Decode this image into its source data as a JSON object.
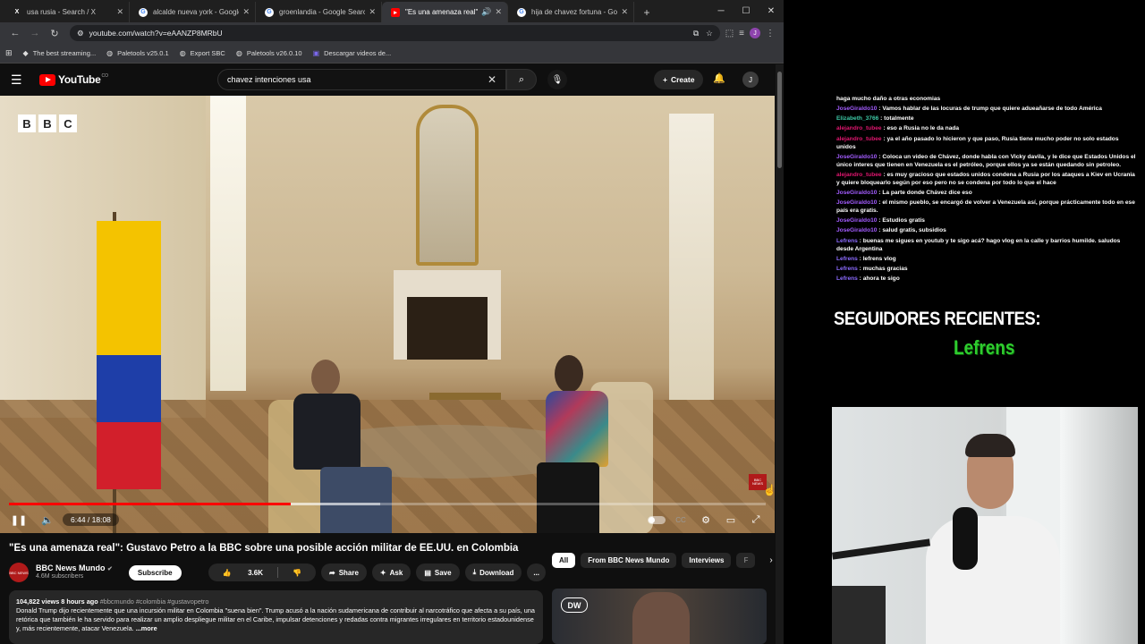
{
  "browser": {
    "tabs": [
      {
        "title": "usa rusia - Search / X",
        "icon": "x-logo-icon",
        "active": false
      },
      {
        "title": "alcalde nueva york - Google Se",
        "icon": "google-icon",
        "active": false
      },
      {
        "title": "groenlandia - Google Search",
        "icon": "google-icon",
        "active": false
      },
      {
        "title": "\"Es una amenaza real\": Gus",
        "icon": "youtube-icon",
        "active": true
      },
      {
        "title": "hija de chavez fortuna - Googl",
        "icon": "google-icon",
        "active": false
      }
    ],
    "new_tab": "+",
    "url": "youtube.com/watch?v=eAANZP8MRbU",
    "bookmarks": [
      "The best streaming...",
      "Paletools v25.0.1",
      "Export SBC",
      "Paletools v26.0.10",
      "Descargar videos de..."
    ],
    "profile_initial": "J"
  },
  "youtube": {
    "logo_text": "YouTube",
    "logo_country": "CO",
    "search_query": "chavez intenciones usa",
    "create_label": "Create",
    "avatar_initial": "J",
    "video": {
      "bbc_letters": [
        "B",
        "B",
        "C"
      ],
      "news_bug": "BBC NEWS",
      "time_current": "6:44",
      "time_total": "18:08",
      "time_display": "6:44 / 18:08",
      "progress_fraction": 0.372,
      "buffer_fraction": 0.49
    },
    "title": "\"Es una amenaza real\": Gustavo Petro a la BBC sobre una posible acción militar de EE.UU. en Colombia",
    "channel": {
      "name": "BBC News Mundo",
      "subscribers": "4.6M subscribers",
      "avatar_text": "BBC NEWS"
    },
    "subscribe_label": "Subscribe",
    "likes": "3.6K",
    "share_label": "Share",
    "ask_label": "Ask",
    "save_label": "Save",
    "download_label": "Download",
    "more_label": "...",
    "description": {
      "meta": "104,822 views  8 hours ago",
      "tags": "#bbcmundo #colombia #gustavopetro",
      "body": "Donald Trump dijo recientemente que una incursión militar en Colombia \"suena bien\". Trump acusó a la nación sudamericana de contribuir al narcotráfico que afecta a su país, una retórica que también le ha servido para realizar un amplio despliegue militar en el Caribe, impulsar detenciones y redadas contra migrantes irregulares en territorio estadounidense y, más recientemente, atacar Venezuela.",
      "more": "...more"
    },
    "chips": [
      "All",
      "From BBC News Mundo",
      "Interviews",
      "F"
    ],
    "rec_thumb_logo": "DW"
  },
  "stream": {
    "chat": [
      {
        "user": "",
        "text": "haga mucho daño a otras economias",
        "color": "#ffffff"
      },
      {
        "user": "JoseGiraldo10",
        "text": "Vamos hablar de las locuras de trump que quiere adueañarse de todo América",
        "color": "#a35cff"
      },
      {
        "user": "Elizabeth_3766",
        "text": "totalmente",
        "color": "#3ec9a7"
      },
      {
        "user": "alejandro_tubee",
        "text": "eso a Rusia no le da nada",
        "color": "#e0166f"
      },
      {
        "user": "alejandro_tubee",
        "text": "ya el año pasado lo hicieron y que paso, Rusia tiene mucho poder no solo estados unidos",
        "color": "#e0166f"
      },
      {
        "user": "JoseGiraldo10",
        "text": "Coloca un video de Chávez, donde habla con Vicky davila, y le dice que Estados Unidos el único interes que tienen en Venezuela es el petróleo, porque ellos ya se están quedando sin petroleo.",
        "color": "#a35cff"
      },
      {
        "user": "alejandro_tubee",
        "text": "es muy gracioso que estados unidos condena a Rusia por los ataques a Kiev en Ucrania y quiere bloquearlo según por eso pero no se condena por todo lo que el hace",
        "color": "#e0166f"
      },
      {
        "user": "JoseGiraldo10",
        "text": "La parte donde Chávez dice eso",
        "color": "#a35cff"
      },
      {
        "user": "JoseGiraldo10",
        "text": "el mismo pueblo, se encargó de volver a Venezuela así, porque prácticamente todo en ese país era gratis.",
        "color": "#a35cff"
      },
      {
        "user": "JoseGiraldo10",
        "text": "Estudios gratis",
        "color": "#a35cff"
      },
      {
        "user": "JoseGiraldo10",
        "text": "salud gratis, subsidios",
        "color": "#a35cff"
      },
      {
        "user": "Lefrens",
        "text": "buenas me sigues en youtub y te sigo acá? hago vlog en la calle y barrios humilde. saludos desde Argentina",
        "color": "#8c6bff"
      },
      {
        "user": "Lefrens",
        "text": "lefrens vlog",
        "color": "#8c6bff"
      },
      {
        "user": "Lefrens",
        "text": "muchas gracias",
        "color": "#8c6bff"
      },
      {
        "user": "Lefrens",
        "text": "ahora te sigo",
        "color": "#8c6bff"
      }
    ],
    "followers_title": "SEGUIDORES RECIENTES:",
    "followers_name": "Lefrens"
  }
}
